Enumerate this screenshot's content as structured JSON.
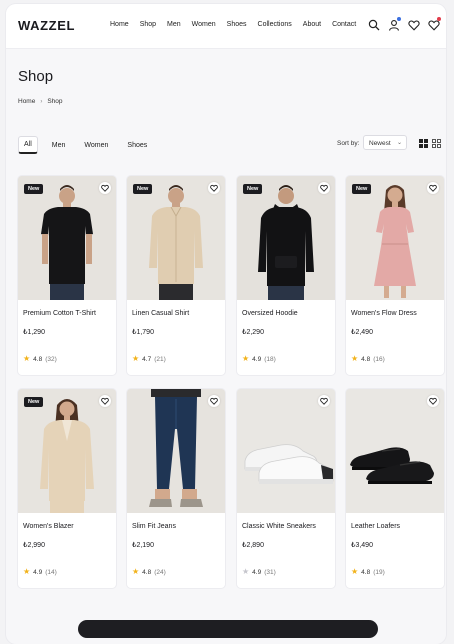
{
  "header": {
    "logo": "WAZZEL",
    "nav": [
      "Home",
      "Shop",
      "Men",
      "Women",
      "Shoes",
      "Collections",
      "About",
      "Contact"
    ]
  },
  "page": {
    "title": "Shop",
    "breadcrumb": [
      "Home",
      "Shop"
    ]
  },
  "filters": {
    "tabs": [
      "All",
      "Men",
      "Women",
      "Shoes"
    ],
    "active_tab": "All",
    "sort_label": "Sort by:",
    "sort_value": "Newest"
  },
  "products": [
    {
      "name": "Premium Cotton T-Shirt",
      "price": "₺1,290",
      "rating": "4.8",
      "reviews": "(32)",
      "badge": "New"
    },
    {
      "name": "Linen Casual Shirt",
      "price": "₺1,790",
      "rating": "4.7",
      "reviews": "(21)",
      "badge": "New"
    },
    {
      "name": "Oversized Hoodie",
      "price": "₺2,290",
      "rating": "4.9",
      "reviews": "(18)",
      "badge": "New"
    },
    {
      "name": "Women's Flow Dress",
      "price": "₺2,490",
      "rating": "4.8",
      "reviews": "(16)",
      "badge": "New"
    },
    {
      "name": "Women's Blazer",
      "price": "₺2,990",
      "rating": "4.9",
      "reviews": "(14)",
      "badge": "New"
    },
    {
      "name": "Slim Fit Jeans",
      "price": "₺2,190",
      "rating": "4.8",
      "reviews": "(24)",
      "badge": ""
    },
    {
      "name": "Classic White Sneakers",
      "price": "₺2,890",
      "rating": "4.9",
      "reviews": "(31)",
      "badge": ""
    },
    {
      "name": "Leather Loafers",
      "price": "₺3,490",
      "rating": "4.8",
      "reviews": "(19)",
      "badge": ""
    }
  ],
  "colors": {
    "accent": "#3b6fe0",
    "badge": "#1c1c20",
    "star": "#f2b21a"
  }
}
